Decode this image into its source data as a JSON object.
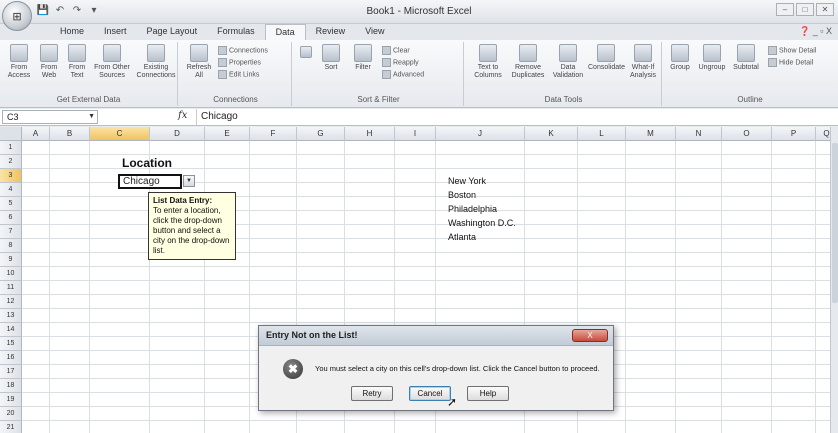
{
  "window": {
    "title": "Book1 - Microsoft Excel",
    "controls": [
      "–",
      "□",
      "✕"
    ]
  },
  "qat": {
    "save": "💾",
    "undo": "↶",
    "redo": "↷",
    "more": "▾"
  },
  "ribbon_tabs": [
    "Home",
    "Insert",
    "Page Layout",
    "Formulas",
    "Data",
    "Review",
    "View"
  ],
  "ribbon_tabs_active": "Data",
  "ribbon_right": "❓ _ ▫ X",
  "ribbon": {
    "external": {
      "label": "Get External Data",
      "buttons": [
        "From Access",
        "From Web",
        "From Text",
        "From Other Sources",
        "Existing Connections"
      ]
    },
    "connections": {
      "label": "Connections",
      "refresh": "Refresh All",
      "small": [
        "Connections",
        "Properties",
        "Edit Links"
      ]
    },
    "sort": {
      "label": "Sort & Filter",
      "sort": "Sort",
      "filter": "Filter",
      "small": [
        "Clear",
        "Reapply",
        "Advanced"
      ]
    },
    "tools": {
      "label": "Data Tools",
      "buttons": [
        "Text to Columns",
        "Remove Duplicates",
        "Data Validation",
        "Consolidate",
        "What-If Analysis"
      ]
    },
    "outline": {
      "label": "Outline",
      "buttons": [
        "Group",
        "Ungroup",
        "Subtotal"
      ],
      "small": [
        "Show Detail",
        "Hide Detail"
      ]
    }
  },
  "formula_bar": {
    "name_box": "C3",
    "fx": "fx",
    "value": "Chicago"
  },
  "columns": [
    "A",
    "B",
    "C",
    "D",
    "E",
    "F",
    "G",
    "H",
    "I",
    "J",
    "K",
    "L",
    "M",
    "N",
    "O",
    "P",
    "Q"
  ],
  "rows": [
    "1",
    "2",
    "3",
    "4",
    "5",
    "6",
    "7",
    "8",
    "9",
    "10",
    "11",
    "12",
    "13",
    "14",
    "15",
    "16",
    "17",
    "18",
    "19",
    "20",
    "21"
  ],
  "sheet": {
    "location_title": "Location",
    "active_value": "Chicago",
    "tooltip_title": "List Data Entry:",
    "tooltip_body": "To enter a location, click the drop-down button and select a city on the drop-down list.",
    "cities": [
      "New York",
      "Boston",
      "Philadelphia",
      "Washington D.C.",
      "Atlanta"
    ]
  },
  "dialog": {
    "title": "Entry Not on the List!",
    "close": "X",
    "icon": "✖",
    "message": "You must select a city on this cell's drop-down list. Click the Cancel button to proceed.",
    "retry": "Retry",
    "cancel": "Cancel",
    "help": "Help"
  }
}
